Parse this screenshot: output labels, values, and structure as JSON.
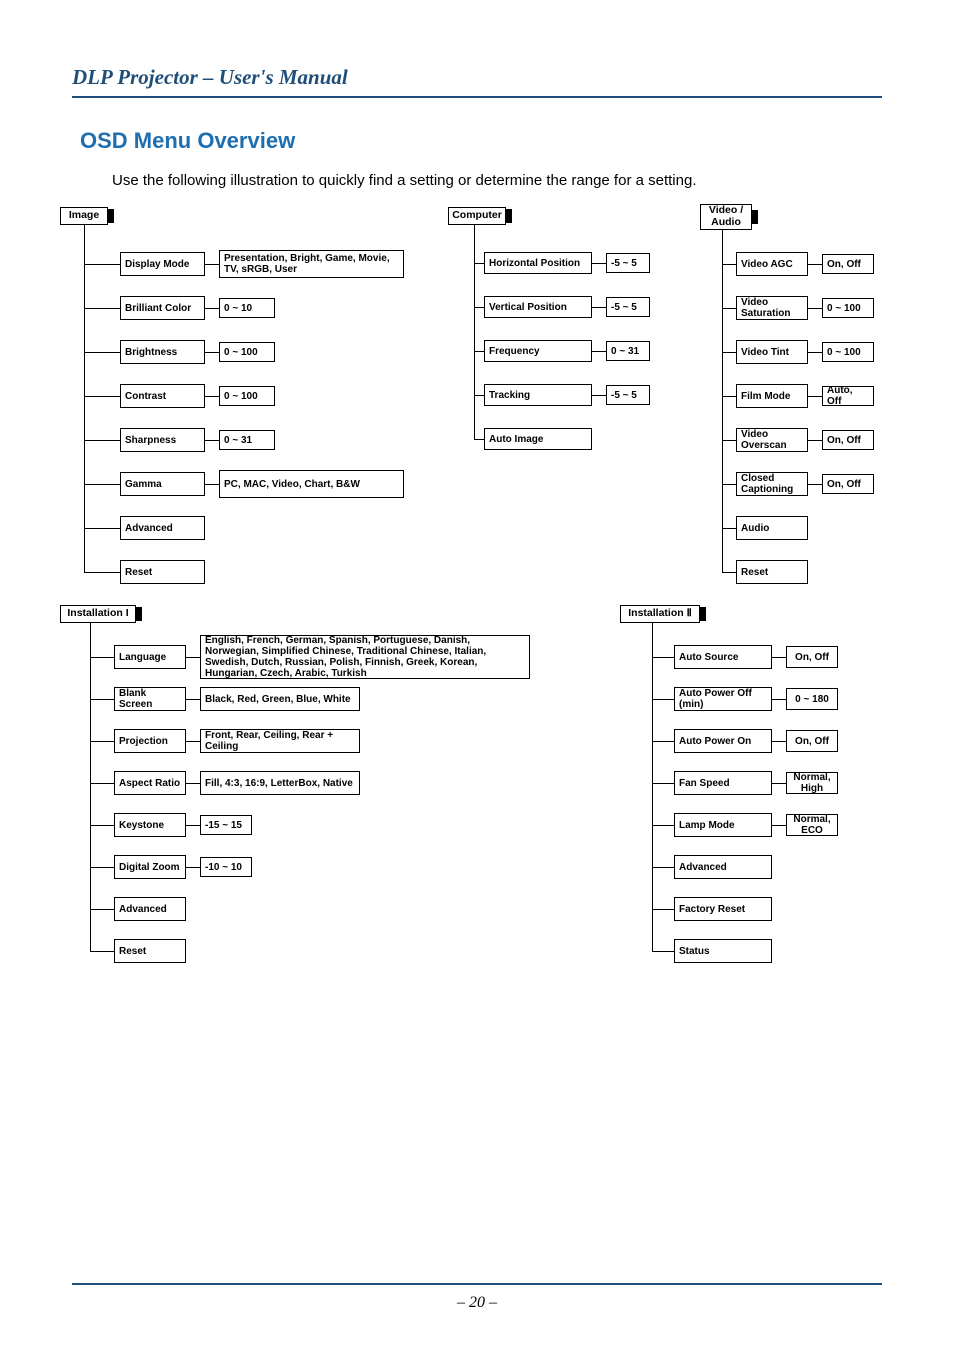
{
  "header": "DLP Projector – User's Manual",
  "section_title": "OSD Menu Overview",
  "intro": "Use the following illustration to quickly find a setting or determine the range for a setting.",
  "page_num": "– 20 –",
  "menus": {
    "image": {
      "root": "Image",
      "items": [
        {
          "label": "Display Mode",
          "value": "Presentation, Bright, Game, Movie, TV, sRGB, User"
        },
        {
          "label": "Brilliant Color",
          "value": "0 ~ 10"
        },
        {
          "label": "Brightness",
          "value": "0 ~ 100"
        },
        {
          "label": "Contrast",
          "value": "0 ~ 100"
        },
        {
          "label": "Sharpness",
          "value": "0 ~ 31"
        },
        {
          "label": "Gamma",
          "value": "PC, MAC, Video, Chart, B&W"
        },
        {
          "label": "Advanced",
          "value": ""
        },
        {
          "label": "Reset",
          "value": ""
        }
      ]
    },
    "computer": {
      "root": "Computer",
      "items": [
        {
          "label": "Horizontal Position",
          "value": "-5 ~ 5"
        },
        {
          "label": "Vertical Position",
          "value": "-5 ~ 5"
        },
        {
          "label": "Frequency",
          "value": "0 ~ 31"
        },
        {
          "label": "Tracking",
          "value": "-5 ~ 5"
        },
        {
          "label": "Auto Image",
          "value": ""
        }
      ]
    },
    "video": {
      "root": "Video / Audio",
      "items": [
        {
          "label": "Video AGC",
          "value": "On, Off"
        },
        {
          "label": "Video Saturation",
          "value": "0 ~ 100"
        },
        {
          "label": "Video Tint",
          "value": "0 ~ 100"
        },
        {
          "label": "Film Mode",
          "value": "Auto, Off"
        },
        {
          "label": "Video Overscan",
          "value": "On, Off"
        },
        {
          "label": "Closed Captioning",
          "value": "On, Off"
        },
        {
          "label": "Audio",
          "value": ""
        },
        {
          "label": "Reset",
          "value": ""
        }
      ]
    },
    "install1": {
      "root": "Installation I",
      "items": [
        {
          "label": "Language",
          "value": "English, French, German, Spanish, Portuguese, Danish, Norwegian, Simplified Chinese, Traditional Chinese, Italian, Swedish, Dutch, Russian, Polish, Finnish, Greek, Korean, Hungarian, Czech, Arabic, Turkish"
        },
        {
          "label": "Blank Screen",
          "value": "Black, Red, Green, Blue, White"
        },
        {
          "label": "Projection",
          "value": "Front, Rear, Ceiling, Rear + Ceiling"
        },
        {
          "label": "Aspect Ratio",
          "value": "Fill, 4:3, 16:9, LetterBox, Native"
        },
        {
          "label": "Keystone",
          "value": "-15 ~ 15"
        },
        {
          "label": "Digital Zoom",
          "value": "-10 ~ 10"
        },
        {
          "label": "Advanced",
          "value": ""
        },
        {
          "label": "Reset",
          "value": ""
        }
      ]
    },
    "install2": {
      "root": "Installation Ⅱ",
      "items": [
        {
          "label": "Auto Source",
          "value": "On, Off"
        },
        {
          "label": "Auto Power Off (min)",
          "value": "0 ~ 180"
        },
        {
          "label": "Auto Power On",
          "value": "On, Off"
        },
        {
          "label": "Fan Speed",
          "value": "Normal, High"
        },
        {
          "label": "Lamp Mode",
          "value": "Normal, ECO"
        },
        {
          "label": "Advanced",
          "value": ""
        },
        {
          "label": "Factory Reset",
          "value": ""
        },
        {
          "label": "Status",
          "value": ""
        }
      ]
    }
  }
}
